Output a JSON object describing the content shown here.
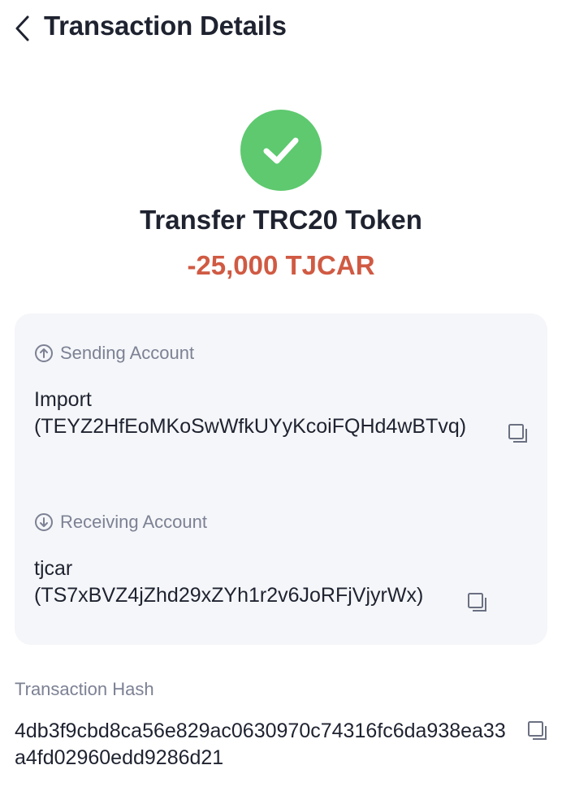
{
  "header": {
    "title": "Transaction Details"
  },
  "status": {
    "icon": "check-icon",
    "color": "#5ec96f"
  },
  "transaction": {
    "type": "Transfer TRC20 Token",
    "amount": "-25,000 TJCAR",
    "amount_color": "#d05a43"
  },
  "sending": {
    "label": "Sending Account",
    "name": "Import",
    "address": "(TEYZ2HfEoMKoSwWfkUYyKcoiFQHd4wBTvq)"
  },
  "receiving": {
    "label": "Receiving Account",
    "name": "tjcar",
    "address": "(TS7xBVZ4jZhd29xZYh1r2v6JoRFjVjyrWx)"
  },
  "hash": {
    "label": "Transaction Hash",
    "value": "4db3f9cbd8ca56e829ac0630970c74316fc6da938ea33a4fd02960edd9286d21"
  }
}
